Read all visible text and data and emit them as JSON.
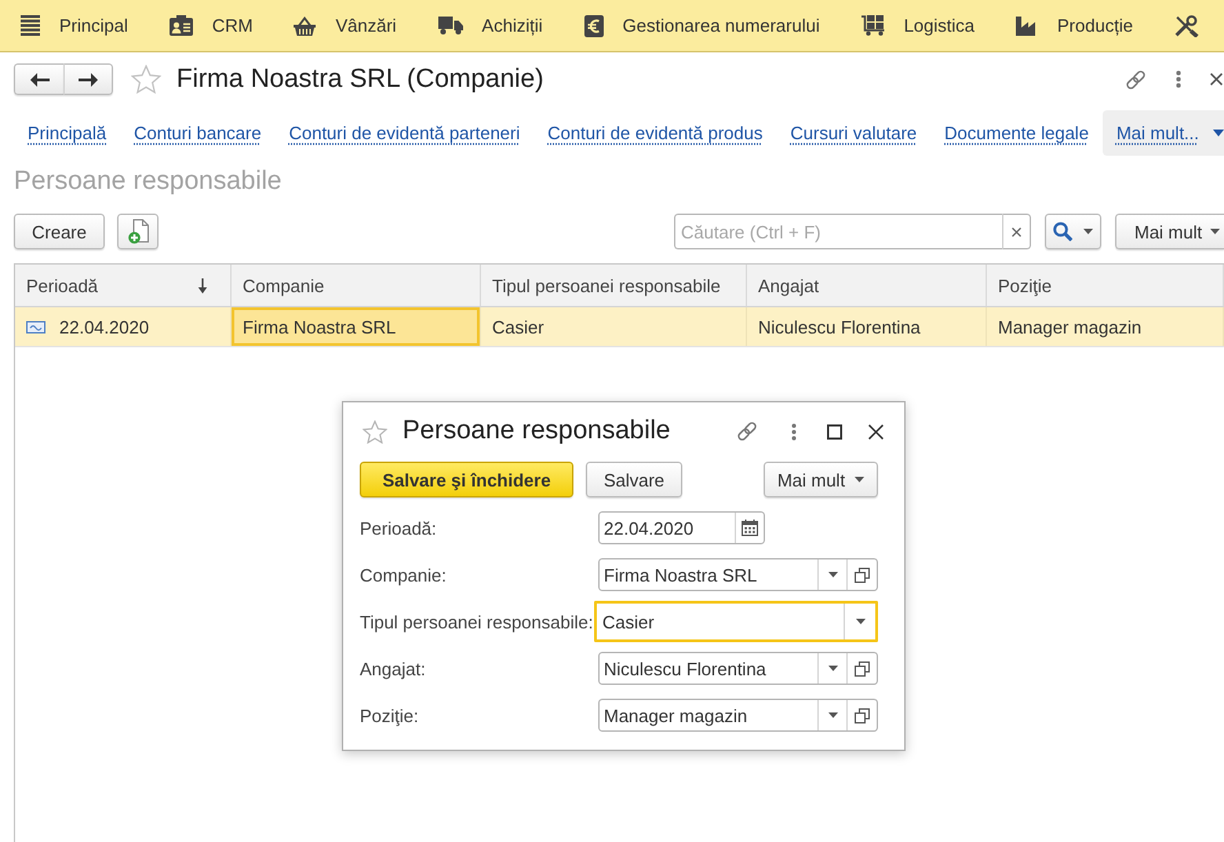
{
  "main_menu": [
    {
      "label": "Principal"
    },
    {
      "label": "CRM"
    },
    {
      "label": "Vânzări"
    },
    {
      "label": "Achiziții"
    },
    {
      "label": "Gestionarea numerarului"
    },
    {
      "label": "Logistica"
    },
    {
      "label": "Producție"
    }
  ],
  "window": {
    "title": "Firma Noastra SRL (Companie)"
  },
  "nav_links": [
    {
      "label": "Principală"
    },
    {
      "label": "Conturi bancare"
    },
    {
      "label": "Conturi de evidentă parteneri"
    },
    {
      "label": "Conturi de evidentă produs"
    },
    {
      "label": "Cursuri valutare"
    },
    {
      "label": "Documente legale"
    }
  ],
  "nav_more": {
    "label": "Mai mult..."
  },
  "section_title": "Persoane responsabile",
  "toolbar": {
    "create_button": "Creare",
    "search": {
      "placeholder": "Căutare (Ctrl + F)"
    },
    "more_button": "Mai mult"
  },
  "table": {
    "columns": [
      {
        "label": "Perioadă",
        "sorted": true
      },
      {
        "label": "Companie",
        "sorted": false
      },
      {
        "label": "Tipul persoanei responsabile",
        "sorted": false
      },
      {
        "label": "Angajat",
        "sorted": false
      },
      {
        "label": "Poziţie",
        "sorted": false
      }
    ],
    "rows": [
      {
        "selected": true,
        "cells": [
          {
            "text": "22.04.2020",
            "selected": false
          },
          {
            "text": "Firma Noastra SRL",
            "selected": true
          },
          {
            "text": "Casier",
            "selected": false
          },
          {
            "text": "Niculescu Florentina",
            "selected": false
          },
          {
            "text": "Manager magazin",
            "selected": false
          }
        ]
      }
    ]
  },
  "dialog": {
    "title": "Persoane responsabile",
    "buttons": [
      {
        "label": "Salvare şi închidere",
        "kind": "primary"
      },
      {
        "label": "Salvare",
        "kind": "normal"
      },
      {
        "label": "Mai mult",
        "kind": "menu"
      }
    ],
    "fields": [
      {
        "label": "Perioadă:",
        "value": "22.04.2020",
        "kind": "date",
        "focused": false
      },
      {
        "label": "Companie:",
        "value": "Firma Noastra SRL",
        "kind": "dropdown_open",
        "focused": false
      },
      {
        "label": "Tipul persoanei responsabile:",
        "value": "Casier",
        "kind": "dropdown",
        "focused": true
      },
      {
        "label": "Angajat:",
        "value": "Niculescu Florentina",
        "kind": "dropdown_open",
        "focused": false
      },
      {
        "label": "Poziţie:",
        "value": "Manager magazin",
        "kind": "dropdown_open",
        "focused": false
      }
    ]
  }
}
